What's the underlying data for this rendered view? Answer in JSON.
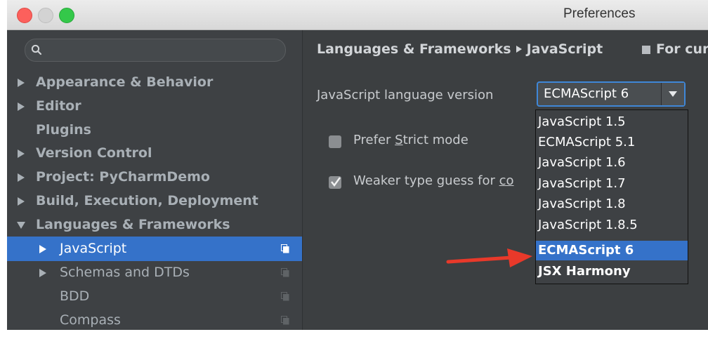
{
  "window": {
    "title": "Preferences"
  },
  "sidebar": {
    "search_placeholder": "",
    "items": [
      {
        "label": "Appearance & Behavior",
        "expandable": true,
        "expanded": false
      },
      {
        "label": "Editor",
        "expandable": true,
        "expanded": false
      },
      {
        "label": "Plugins",
        "expandable": false
      },
      {
        "label": "Version Control",
        "expandable": true,
        "expanded": false
      },
      {
        "label": "Project: PyCharmDemo",
        "expandable": true,
        "expanded": false
      },
      {
        "label": "Build, Execution, Deployment",
        "expandable": true,
        "expanded": false
      },
      {
        "label": "Languages & Frameworks",
        "expandable": true,
        "expanded": true
      },
      {
        "label": "JavaScript",
        "expandable": true,
        "expanded": false,
        "selected": true
      },
      {
        "label": "Schemas and DTDs",
        "expandable": true,
        "expanded": false
      },
      {
        "label": "BDD",
        "expandable": false
      },
      {
        "label": "Compass",
        "expandable": false
      }
    ]
  },
  "content": {
    "breadcrumb": [
      "Languages & Frameworks",
      "JavaScript"
    ],
    "breadcrumb_extra": "For cur",
    "language_version_label": "JavaScript language version",
    "language_version_value": "ECMAScript 6",
    "prefer_strict": {
      "label_pre": "Prefer ",
      "label_u": "S",
      "label_post": "trict mode",
      "checked": false
    },
    "weaker_type": {
      "label_pre": "Weaker type guess for ",
      "label_u": "co",
      "checked": true
    },
    "dropdown_options": [
      "JavaScript 1.5",
      "ECMAScript 5.1",
      "JavaScript 1.6",
      "JavaScript 1.7",
      "JavaScript 1.8",
      "JavaScript 1.8.5",
      "ECMAScript 6",
      "JSX Harmony"
    ],
    "dropdown_selected_index": 6
  },
  "colors": {
    "selection": "#3572c9",
    "annotation_arrow": "#e8392a"
  }
}
